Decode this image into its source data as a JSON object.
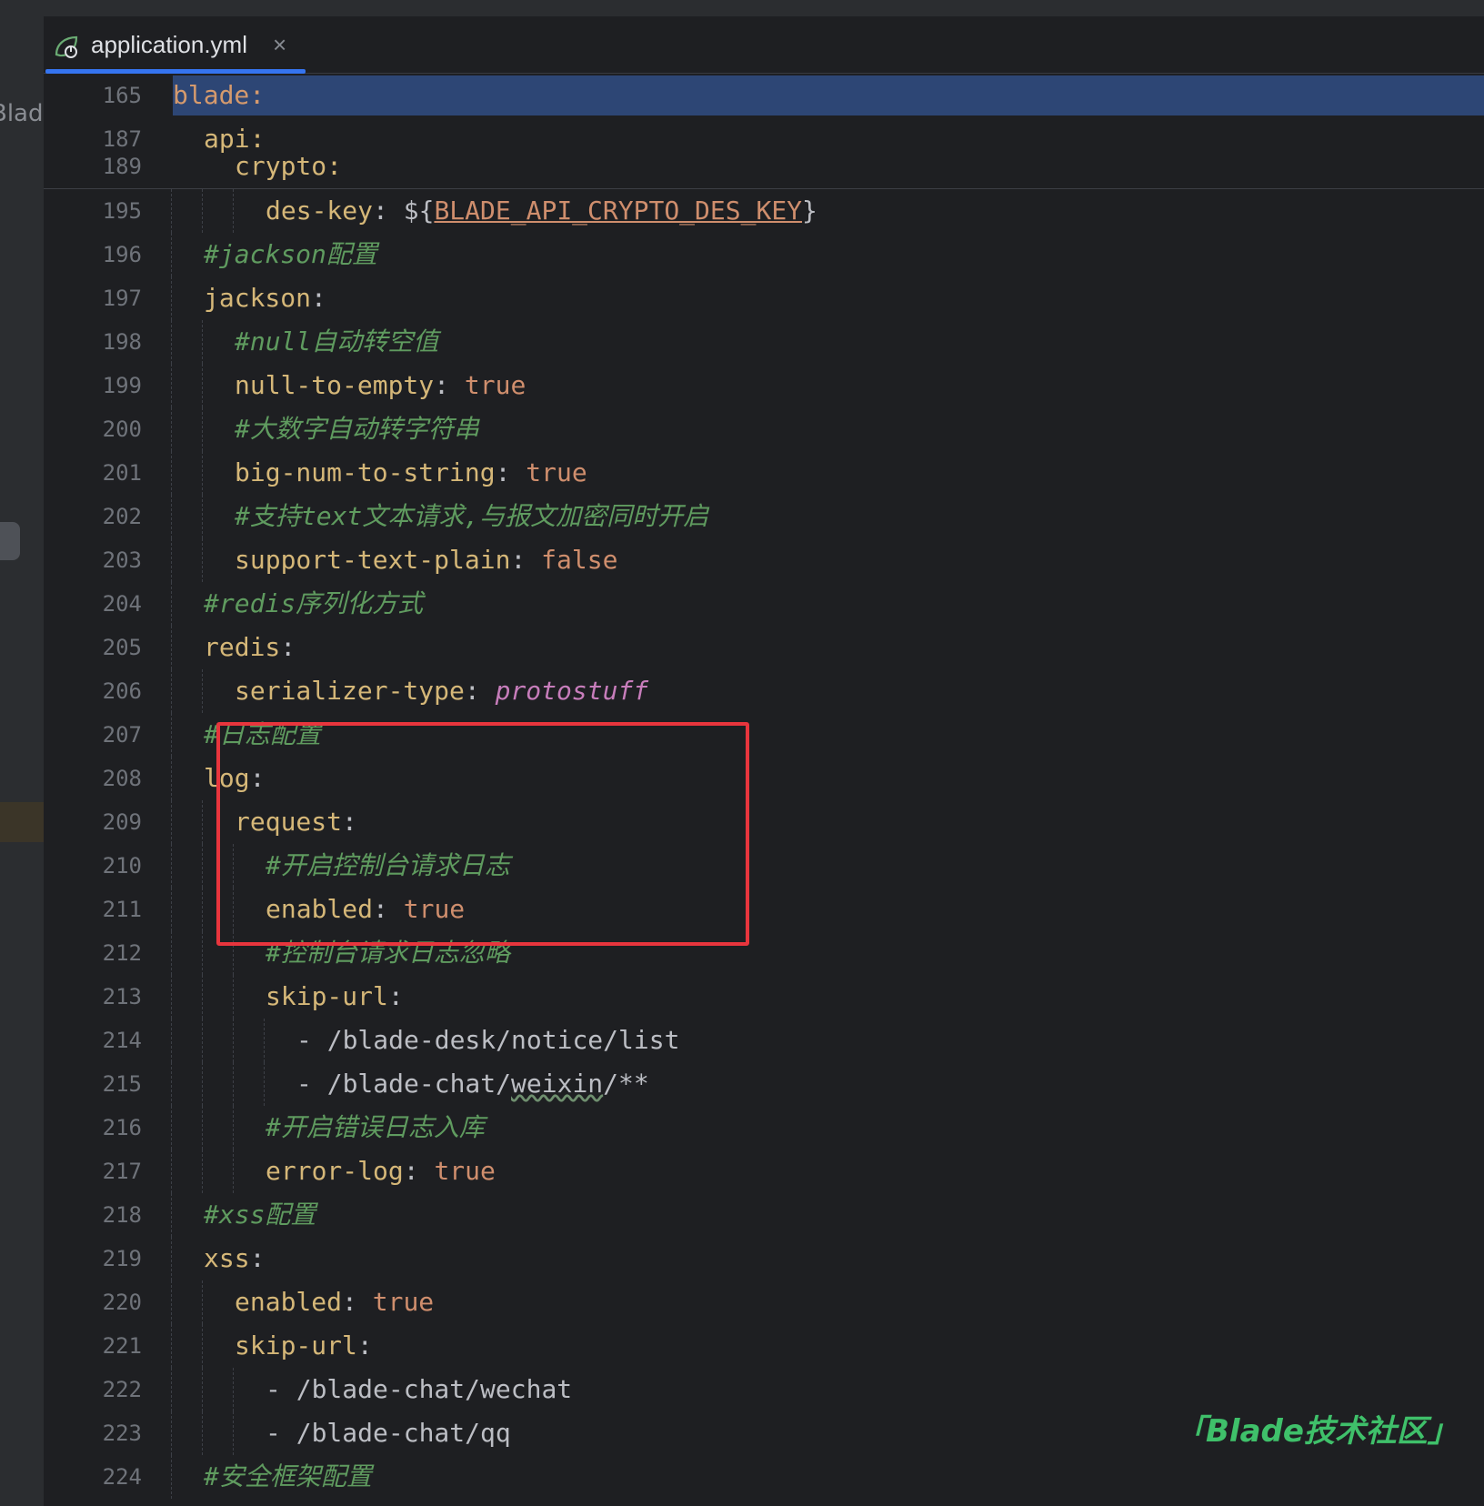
{
  "sidebar": {
    "partial_text": "Blad"
  },
  "tab": {
    "title": "application.yml",
    "close_glyph": "×"
  },
  "sticky_lines": [
    {
      "num": "165",
      "text": "blade:",
      "highlight": true,
      "indent": 0
    },
    {
      "num": "187",
      "text": "api:",
      "indent": 1
    },
    {
      "num": "189",
      "text": "crypto:",
      "indent": 2,
      "clipped": true
    }
  ],
  "lines": [
    {
      "num": "195",
      "indent": 3,
      "tokens": [
        {
          "t": "des-key",
          "c": "k"
        },
        {
          "t": ": ",
          "c": "p"
        },
        {
          "t": "${",
          "c": "s"
        },
        {
          "t": "BLADE_API_CRYPTO_DES_KEY",
          "c": "u"
        },
        {
          "t": "}",
          "c": "s"
        }
      ]
    },
    {
      "num": "196",
      "indent": 1,
      "tokens": [
        {
          "t": "#jackson配置",
          "c": "c"
        }
      ]
    },
    {
      "num": "197",
      "indent": 1,
      "tokens": [
        {
          "t": "jackson",
          "c": "k"
        },
        {
          "t": ":",
          "c": "p"
        }
      ]
    },
    {
      "num": "198",
      "indent": 2,
      "tokens": [
        {
          "t": "#null自动转空值",
          "c": "c"
        }
      ]
    },
    {
      "num": "199",
      "indent": 2,
      "tokens": [
        {
          "t": "null-to-empty",
          "c": "k"
        },
        {
          "t": ": ",
          "c": "p"
        },
        {
          "t": "true",
          "c": "v"
        }
      ]
    },
    {
      "num": "200",
      "indent": 2,
      "tokens": [
        {
          "t": "#大数字自动转字符串",
          "c": "c"
        }
      ]
    },
    {
      "num": "201",
      "indent": 2,
      "tokens": [
        {
          "t": "big-num-to-string",
          "c": "k"
        },
        {
          "t": ": ",
          "c": "p"
        },
        {
          "t": "true",
          "c": "v"
        }
      ]
    },
    {
      "num": "202",
      "indent": 2,
      "tokens": [
        {
          "t": "#支持text文本请求,与报文加密同时开启",
          "c": "c"
        }
      ]
    },
    {
      "num": "203",
      "indent": 2,
      "tokens": [
        {
          "t": "support-text-plain",
          "c": "k"
        },
        {
          "t": ": ",
          "c": "p"
        },
        {
          "t": "false",
          "c": "v"
        }
      ]
    },
    {
      "num": "204",
      "indent": 1,
      "tokens": [
        {
          "t": "#redis序列化方式",
          "c": "c"
        }
      ]
    },
    {
      "num": "205",
      "indent": 1,
      "tokens": [
        {
          "t": "redis",
          "c": "k"
        },
        {
          "t": ":",
          "c": "p"
        }
      ]
    },
    {
      "num": "206",
      "indent": 2,
      "tokens": [
        {
          "t": "serializer-type",
          "c": "k"
        },
        {
          "t": ": ",
          "c": "p"
        },
        {
          "t": "protostuff",
          "c": "it"
        }
      ]
    },
    {
      "num": "207",
      "indent": 1,
      "tokens": [
        {
          "t": "#日志配置",
          "c": "c"
        }
      ]
    },
    {
      "num": "208",
      "indent": 1,
      "tokens": [
        {
          "t": "log",
          "c": "k"
        },
        {
          "t": ":",
          "c": "p"
        }
      ]
    },
    {
      "num": "209",
      "indent": 2,
      "tokens": [
        {
          "t": "request",
          "c": "k"
        },
        {
          "t": ":",
          "c": "p"
        }
      ]
    },
    {
      "num": "210",
      "indent": 3,
      "tokens": [
        {
          "t": "#开启控制台请求日志",
          "c": "c"
        }
      ]
    },
    {
      "num": "211",
      "indent": 3,
      "tokens": [
        {
          "t": "enabled",
          "c": "k"
        },
        {
          "t": ": ",
          "c": "p"
        },
        {
          "t": "true",
          "c": "v"
        }
      ]
    },
    {
      "num": "212",
      "indent": 3,
      "tokens": [
        {
          "t": "#控制台请求日志忽略",
          "c": "c"
        }
      ]
    },
    {
      "num": "213",
      "indent": 3,
      "tokens": [
        {
          "t": "skip-url",
          "c": "k"
        },
        {
          "t": ":",
          "c": "p"
        }
      ]
    },
    {
      "num": "214",
      "indent": 4,
      "tokens": [
        {
          "t": "- ",
          "c": "p"
        },
        {
          "t": "/blade-desk/notice/list",
          "c": "s"
        }
      ]
    },
    {
      "num": "215",
      "indent": 4,
      "tokens": [
        {
          "t": "- ",
          "c": "p"
        },
        {
          "t": "/blade-chat/",
          "c": "s"
        },
        {
          "t": "weixin",
          "c": "w"
        },
        {
          "t": "/**",
          "c": "s"
        }
      ]
    },
    {
      "num": "216",
      "indent": 3,
      "tokens": [
        {
          "t": "#开启错误日志入库",
          "c": "c"
        }
      ]
    },
    {
      "num": "217",
      "indent": 3,
      "tokens": [
        {
          "t": "error-log",
          "c": "k"
        },
        {
          "t": ": ",
          "c": "p"
        },
        {
          "t": "true",
          "c": "v"
        }
      ]
    },
    {
      "num": "218",
      "indent": 1,
      "tokens": [
        {
          "t": "#xss配置",
          "c": "c"
        }
      ]
    },
    {
      "num": "219",
      "indent": 1,
      "tokens": [
        {
          "t": "xss",
          "c": "k"
        },
        {
          "t": ":",
          "c": "p"
        }
      ]
    },
    {
      "num": "220",
      "indent": 2,
      "tokens": [
        {
          "t": "enabled",
          "c": "k"
        },
        {
          "t": ": ",
          "c": "p"
        },
        {
          "t": "true",
          "c": "v"
        }
      ]
    },
    {
      "num": "221",
      "indent": 2,
      "tokens": [
        {
          "t": "skip-url",
          "c": "k"
        },
        {
          "t": ":",
          "c": "p"
        }
      ]
    },
    {
      "num": "222",
      "indent": 3,
      "tokens": [
        {
          "t": "- ",
          "c": "p"
        },
        {
          "t": "/blade-chat/wechat",
          "c": "s"
        }
      ]
    },
    {
      "num": "223",
      "indent": 3,
      "tokens": [
        {
          "t": "- ",
          "c": "p"
        },
        {
          "t": "/blade-chat/qq",
          "c": "s"
        }
      ]
    },
    {
      "num": "224",
      "indent": 1,
      "tokens": [
        {
          "t": "#安全框架配置",
          "c": "c"
        }
      ]
    }
  ],
  "annotation": {
    "label": "highlighted log config block",
    "color": "#e8353d"
  },
  "watermark": {
    "open": "「",
    "text": "Blade技术社区",
    "close": "」",
    "color": "#3fc06a"
  },
  "colors": {
    "key": "#d5b778",
    "comment": "#5f9b5f",
    "value": "#cf8e6d",
    "italic_value": "#c77dbb",
    "selection": "#2d4675",
    "tab_underline": "#3574f0"
  }
}
